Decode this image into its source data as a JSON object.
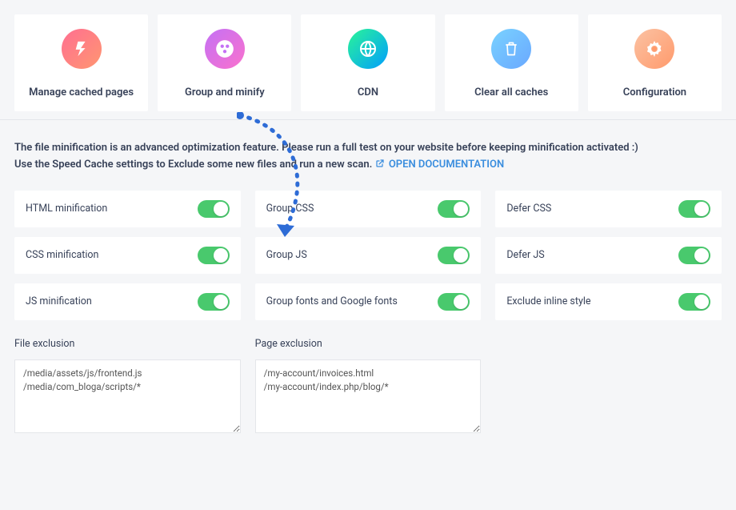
{
  "cards": [
    {
      "label": "Manage cached pages",
      "icon": "bolt-icon"
    },
    {
      "label": "Group and minify",
      "icon": "palette-icon"
    },
    {
      "label": "CDN",
      "icon": "globe-icon"
    },
    {
      "label": "Clear all caches",
      "icon": "trash-icon"
    },
    {
      "label": "Configuration",
      "icon": "gear-icon"
    }
  ],
  "desc": {
    "line1": "The file minification is an advanced optimization feature. Please run a full test on your website before keeping minification activated :)",
    "line2_prefix": "Use the Speed Cache settings to Exclude some new files and run a new scan.",
    "doc_link": "OPEN DOCUMENTATION"
  },
  "toggles": [
    {
      "label": "HTML minification",
      "on": true
    },
    {
      "label": "Group CSS",
      "on": true
    },
    {
      "label": "Defer CSS",
      "on": true
    },
    {
      "label": "CSS minification",
      "on": true
    },
    {
      "label": "Group JS",
      "on": true
    },
    {
      "label": "Defer JS",
      "on": true
    },
    {
      "label": "JS minification",
      "on": true
    },
    {
      "label": "Group fonts and Google fonts",
      "on": true
    },
    {
      "label": "Exclude inline style",
      "on": true
    }
  ],
  "exclusions": {
    "file": {
      "label": "File exclusion",
      "value": "/media/assets/js/frontend.js\n/media/com_bloga/scripts/*"
    },
    "page": {
      "label": "Page exclusion",
      "value": "/my-account/invoices.html\n/my-account/index.php/blog/*"
    }
  }
}
